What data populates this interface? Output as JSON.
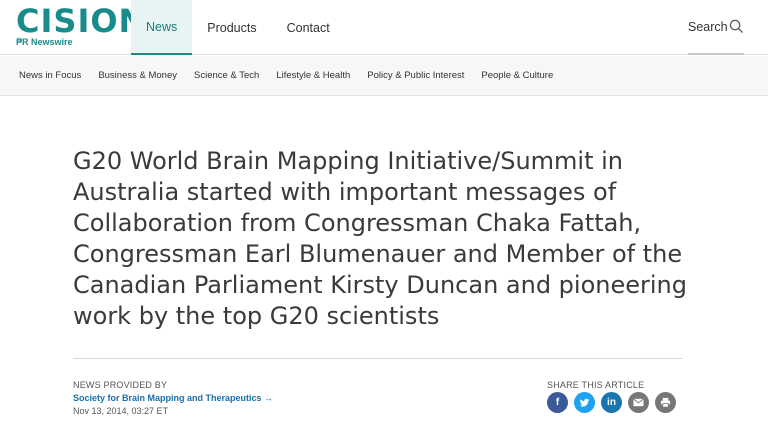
{
  "header": {
    "logo_text": "CISION",
    "logo_reg": "®",
    "logo_sub": "PR Newswire",
    "nav": [
      {
        "label": "News",
        "active": true
      },
      {
        "label": "Products",
        "active": false
      },
      {
        "label": "Contact",
        "active": false
      }
    ],
    "search_label": "Search"
  },
  "subnav": {
    "items": [
      "News in Focus",
      "Business & Money",
      "Science & Tech",
      "Lifestyle & Health",
      "Policy & Public Interest",
      "People & Culture"
    ]
  },
  "article": {
    "headline": "G20 World Brain Mapping Initiative/Summit in Australia started with important messages of Collaboration from Congressman Chaka Fattah, Congressman Earl Blumenauer and Member of the Canadian Parliament Kirsty Duncan and pioneering work by the top G20 scientists",
    "provided_label": "NEWS PROVIDED BY",
    "provider": "Society for Brain Mapping and Therapeutics →",
    "date": "Nov 13, 2014, 03:27 ET",
    "share_label": "SHARE THIS ARTICLE",
    "share_icons": [
      "facebook-icon",
      "twitter-icon",
      "linkedin-icon",
      "email-icon",
      "print-icon"
    ]
  },
  "colors": {
    "brand": "#1a8b8b",
    "link": "#1a6fa8",
    "facebook": "#3b5a9a",
    "twitter": "#1da1f2",
    "linkedin": "#1a75b0"
  }
}
